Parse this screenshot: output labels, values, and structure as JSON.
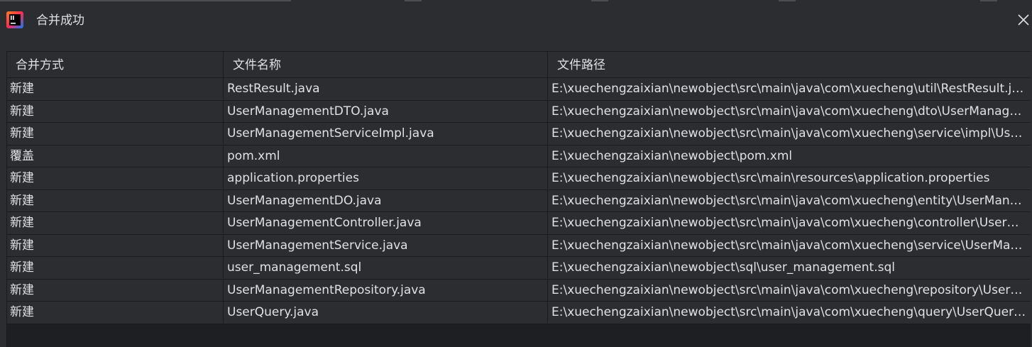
{
  "window": {
    "title": "合并成功",
    "logo_icon": "intellij-idea-icon",
    "close_icon": "close-icon"
  },
  "table": {
    "columns": [
      "合并方式",
      "文件名称",
      "文件路径"
    ],
    "rows": [
      {
        "mode": "新建",
        "name": "RestResult.java",
        "path": "E:\\xuechengzaixian\\newobject\\src\\main\\java\\com\\xuecheng\\util\\RestResult.java"
      },
      {
        "mode": "新建",
        "name": "UserManagementDTO.java",
        "path": "E:\\xuechengzaixian\\newobject\\src\\main\\java\\com\\xuecheng\\dto\\UserManagementDTO.java"
      },
      {
        "mode": "新建",
        "name": "UserManagementServiceImpl.java",
        "path": "E:\\xuechengzaixian\\newobject\\src\\main\\java\\com\\xuecheng\\service\\impl\\UserManagementServiceImpl.java"
      },
      {
        "mode": "覆盖",
        "name": "pom.xml",
        "path": "E:\\xuechengzaixian\\newobject\\pom.xml"
      },
      {
        "mode": "新建",
        "name": "application.properties",
        "path": "E:\\xuechengzaixian\\newobject\\src\\main\\resources\\application.properties"
      },
      {
        "mode": "新建",
        "name": "UserManagementDO.java",
        "path": "E:\\xuechengzaixian\\newobject\\src\\main\\java\\com\\xuecheng\\entity\\UserManagementDO.java"
      },
      {
        "mode": "新建",
        "name": "UserManagementController.java",
        "path": "E:\\xuechengzaixian\\newobject\\src\\main\\java\\com\\xuecheng\\controller\\UserManagementController.java"
      },
      {
        "mode": "新建",
        "name": "UserManagementService.java",
        "path": "E:\\xuechengzaixian\\newobject\\src\\main\\java\\com\\xuecheng\\service\\UserManagementService.java"
      },
      {
        "mode": "新建",
        "name": "user_management.sql",
        "path": "E:\\xuechengzaixian\\newobject\\sql\\user_management.sql"
      },
      {
        "mode": "新建",
        "name": "UserManagementRepository.java",
        "path": "E:\\xuechengzaixian\\newobject\\src\\main\\java\\com\\xuecheng\\repository\\UserManagementRepository.java"
      },
      {
        "mode": "新建",
        "name": "UserQuery.java",
        "path": "E:\\xuechengzaixian\\newobject\\src\\main\\java\\com\\xuecheng\\query\\UserQuery.java"
      }
    ]
  },
  "colors": {
    "background": "#2b2d30",
    "table_background": "#1e1f22",
    "text": "#dfe1e5",
    "grid": "#1a1b1e"
  }
}
